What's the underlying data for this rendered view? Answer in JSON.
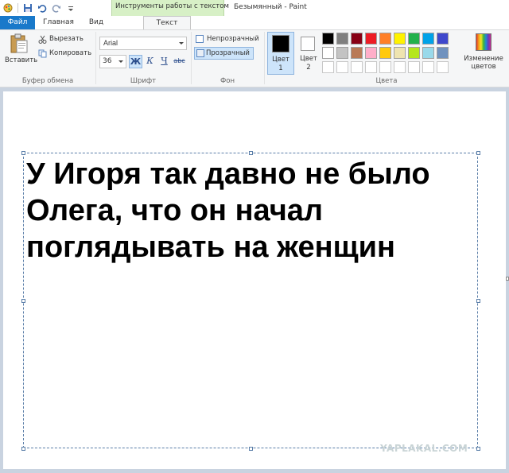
{
  "window": {
    "app_title": "Безымянный - Paint",
    "context_group_title": "Инструменты работы с текстом"
  },
  "quick_access": {
    "icons": [
      "paint-app-icon",
      "save-icon",
      "undo-icon",
      "redo-icon",
      "customize-dropdown-icon"
    ]
  },
  "tabs": {
    "file": "Файл",
    "home": "Главная",
    "view": "Вид",
    "text": "Текст"
  },
  "clipboard": {
    "group_label": "Буфер обмена",
    "paste_label": "Вставить",
    "cut_label": "Вырезать",
    "copy_label": "Копировать"
  },
  "font": {
    "group_label": "Шрифт",
    "family": "Arial",
    "size": "36",
    "bold_glyph": "Ж",
    "italic_glyph": "К",
    "underline_glyph": "Ч",
    "strike_glyph": "abc"
  },
  "background": {
    "group_label": "Фон",
    "opaque_label": "Непрозрачный",
    "transparent_label": "Прозрачный"
  },
  "colors": {
    "group_label": "Цвета",
    "color1_label_line1": "Цвет",
    "color1_label_line2": "1",
    "color2_label_line1": "Цвет",
    "color2_label_line2": "2",
    "color1_value": "#000000",
    "color2_value": "#ffffff",
    "edit_colors_line1": "Изменение",
    "edit_colors_line2": "цветов",
    "palette": [
      "#000000",
      "#7f7f7f",
      "#880015",
      "#ed1c24",
      "#ff7f27",
      "#fff200",
      "#22b14c",
      "#00a2e8",
      "#3f48cc",
      "#a349a4",
      "#ffffff",
      "#c3c3c3",
      "#b97a57",
      "#ffaec9",
      "#ffc90e",
      "#efe4b0",
      "#b5e61d",
      "#99d9ea",
      "#7092be",
      "#c8bfe7",
      "#ffffff",
      "#ffffff",
      "#ffffff",
      "#ffffff",
      "#ffffff",
      "#ffffff",
      "#ffffff",
      "#ffffff",
      "#ffffff",
      "#ffffff"
    ]
  },
  "canvas": {
    "text_lines": [
      "У Игоря так давно не было",
      "Олега, что он начал",
      "поглядывать на женщин"
    ],
    "watermark": "YAPLAKAL.COM"
  }
}
